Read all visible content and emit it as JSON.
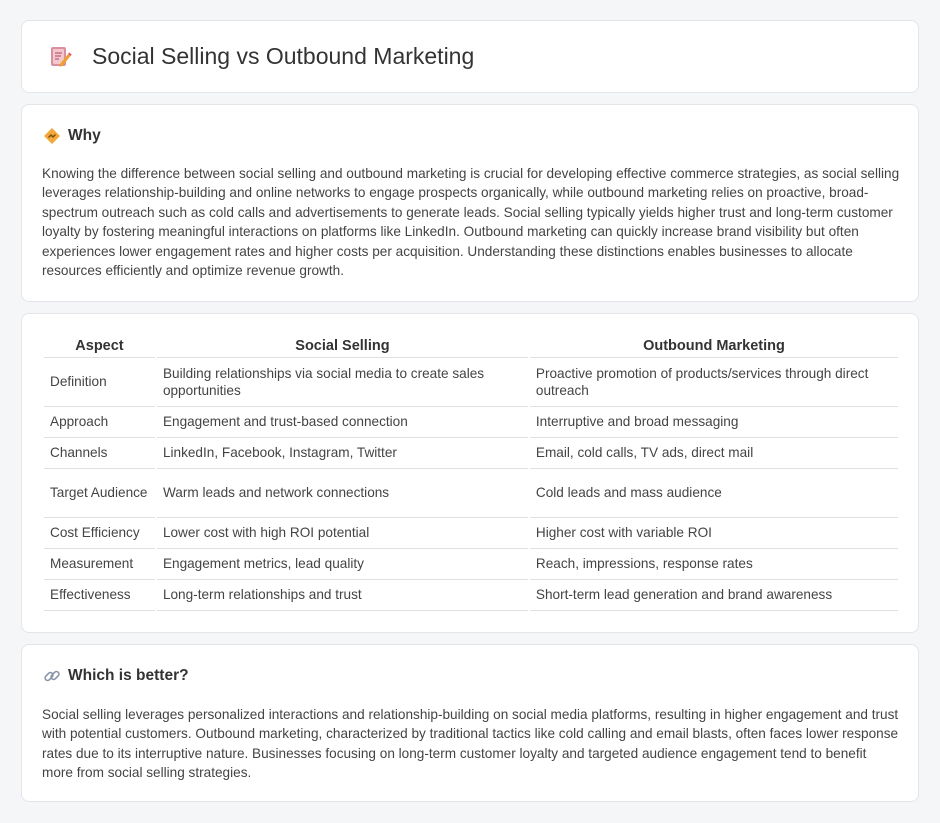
{
  "page": {
    "title": "Social Selling vs Outbound Marketing",
    "icon": "document-edit-icon"
  },
  "why": {
    "heading": "Why",
    "icon": "diamond-sign-icon",
    "text": "Knowing the difference between social selling and outbound marketing is crucial for developing effective commerce strategies, as social selling leverages relationship-building and online networks to engage prospects organically, while outbound marketing relies on proactive, broad-spectrum outreach such as cold calls and advertisements to generate leads. Social selling typically yields higher trust and long-term customer loyalty by fostering meaningful interactions on platforms like LinkedIn. Outbound marketing can quickly increase brand visibility but often experiences lower engagement rates and higher costs per acquisition. Understanding these distinctions enables businesses to allocate resources efficiently and optimize revenue growth."
  },
  "table": {
    "headers": [
      "Aspect",
      "Social Selling",
      "Outbound Marketing"
    ],
    "rows": [
      [
        "Definition",
        "Building relationships via social media to create sales opportunities",
        "Proactive promotion of products/services through direct outreach"
      ],
      [
        "Approach",
        "Engagement and trust-based connection",
        "Interruptive and broad messaging"
      ],
      [
        "Channels",
        "LinkedIn, Facebook, Instagram, Twitter",
        "Email, cold calls, TV ads, direct mail"
      ],
      [
        "Target Audience",
        "Warm leads and network connections",
        "Cold leads and mass audience"
      ],
      [
        "Cost Efficiency",
        "Lower cost with high ROI potential",
        "Higher cost with variable ROI"
      ],
      [
        "Measurement",
        "Engagement metrics, lead quality",
        "Reach, impressions, response rates"
      ],
      [
        "Effectiveness",
        "Long-term relationships and trust",
        "Short-term lead generation and brand awareness"
      ]
    ]
  },
  "better": {
    "heading": "Which is better?",
    "icon": "link-icon",
    "text": "Social selling leverages personalized interactions and relationship-building on social media platforms, resulting in higher engagement and trust with potential customers. Outbound marketing, characterized by traditional tactics like cold calling and email blasts, often faces lower response rates due to its interruptive nature. Businesses focusing on long-term customer loyalty and targeted audience engagement tend to benefit more from social selling strategies."
  }
}
